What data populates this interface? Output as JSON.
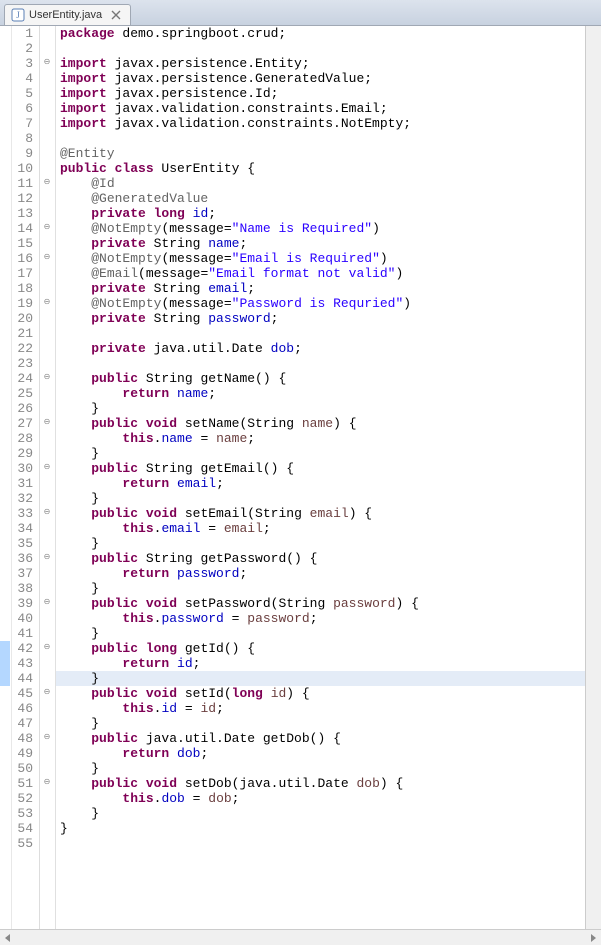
{
  "tab": {
    "filename": "UserEntity.java"
  },
  "lines": [
    {
      "n": 1,
      "m": "",
      "tokens": [
        [
          "kw",
          "package"
        ],
        [
          "id",
          " demo.springboot.crud;"
        ]
      ]
    },
    {
      "n": 2,
      "m": "",
      "tokens": []
    },
    {
      "n": 3,
      "m": "fold",
      "tokens": [
        [
          "kw",
          "import"
        ],
        [
          "id",
          " javax.persistence.Entity;"
        ]
      ]
    },
    {
      "n": 4,
      "m": "",
      "tokens": [
        [
          "kw",
          "import"
        ],
        [
          "id",
          " javax.persistence.GeneratedValue;"
        ]
      ]
    },
    {
      "n": 5,
      "m": "",
      "tokens": [
        [
          "kw",
          "import"
        ],
        [
          "id",
          " javax.persistence.Id;"
        ]
      ]
    },
    {
      "n": 6,
      "m": "",
      "tokens": [
        [
          "kw",
          "import"
        ],
        [
          "id",
          " javax.validation.constraints.Email;"
        ]
      ]
    },
    {
      "n": 7,
      "m": "",
      "tokens": [
        [
          "kw",
          "import"
        ],
        [
          "id",
          " javax.validation.constraints.NotEmpty;"
        ]
      ]
    },
    {
      "n": 8,
      "m": "",
      "tokens": []
    },
    {
      "n": 9,
      "m": "",
      "tokens": [
        [
          "ann",
          "@Entity"
        ]
      ]
    },
    {
      "n": 10,
      "m": "",
      "tokens": [
        [
          "kw",
          "public class"
        ],
        [
          "id",
          " UserEntity {"
        ]
      ]
    },
    {
      "n": 11,
      "m": "fold",
      "tokens": [
        [
          "id",
          "    "
        ],
        [
          "ann",
          "@Id"
        ]
      ]
    },
    {
      "n": 12,
      "m": "",
      "tokens": [
        [
          "id",
          "    "
        ],
        [
          "ann",
          "@GeneratedValue"
        ]
      ]
    },
    {
      "n": 13,
      "m": "",
      "tokens": [
        [
          "id",
          "    "
        ],
        [
          "kw",
          "private long"
        ],
        [
          "id",
          " "
        ],
        [
          "field",
          "id"
        ],
        [
          "id",
          ";"
        ]
      ]
    },
    {
      "n": 14,
      "m": "fold",
      "tokens": [
        [
          "id",
          "    "
        ],
        [
          "ann",
          "@NotEmpty"
        ],
        [
          "id",
          "(message="
        ],
        [
          "str",
          "\"Name is Required\""
        ],
        [
          "id",
          ")"
        ]
      ]
    },
    {
      "n": 15,
      "m": "",
      "tokens": [
        [
          "id",
          "    "
        ],
        [
          "kw",
          "private"
        ],
        [
          "id",
          " String "
        ],
        [
          "field",
          "name"
        ],
        [
          "id",
          ";"
        ]
      ]
    },
    {
      "n": 16,
      "m": "fold",
      "tokens": [
        [
          "id",
          "    "
        ],
        [
          "ann",
          "@NotEmpty"
        ],
        [
          "id",
          "(message="
        ],
        [
          "str",
          "\"Email is Required\""
        ],
        [
          "id",
          ")"
        ]
      ]
    },
    {
      "n": 17,
      "m": "",
      "tokens": [
        [
          "id",
          "    "
        ],
        [
          "ann",
          "@Email"
        ],
        [
          "id",
          "(message="
        ],
        [
          "str",
          "\"Email format not valid\""
        ],
        [
          "id",
          ")"
        ]
      ]
    },
    {
      "n": 18,
      "m": "",
      "tokens": [
        [
          "id",
          "    "
        ],
        [
          "kw",
          "private"
        ],
        [
          "id",
          " String "
        ],
        [
          "field",
          "email"
        ],
        [
          "id",
          ";"
        ]
      ]
    },
    {
      "n": 19,
      "m": "fold",
      "tokens": [
        [
          "id",
          "    "
        ],
        [
          "ann",
          "@NotEmpty"
        ],
        [
          "id",
          "(message="
        ],
        [
          "str",
          "\"Password is Requried\""
        ],
        [
          "id",
          ")"
        ]
      ]
    },
    {
      "n": 20,
      "m": "",
      "tokens": [
        [
          "id",
          "    "
        ],
        [
          "kw",
          "private"
        ],
        [
          "id",
          " String "
        ],
        [
          "field",
          "password"
        ],
        [
          "id",
          ";"
        ]
      ]
    },
    {
      "n": 21,
      "m": "",
      "tokens": []
    },
    {
      "n": 22,
      "m": "",
      "tokens": [
        [
          "id",
          "    "
        ],
        [
          "kw",
          "private"
        ],
        [
          "id",
          " java.util.Date "
        ],
        [
          "field",
          "dob"
        ],
        [
          "id",
          ";"
        ]
      ]
    },
    {
      "n": 23,
      "m": "",
      "tokens": []
    },
    {
      "n": 24,
      "m": "fold",
      "tokens": [
        [
          "id",
          "    "
        ],
        [
          "kw",
          "public"
        ],
        [
          "id",
          " String getName() {"
        ]
      ]
    },
    {
      "n": 25,
      "m": "",
      "tokens": [
        [
          "id",
          "        "
        ],
        [
          "kw",
          "return"
        ],
        [
          "id",
          " "
        ],
        [
          "field",
          "name"
        ],
        [
          "id",
          ";"
        ]
      ]
    },
    {
      "n": 26,
      "m": "",
      "tokens": [
        [
          "id",
          "    }"
        ]
      ]
    },
    {
      "n": 27,
      "m": "fold",
      "tokens": [
        [
          "id",
          "    "
        ],
        [
          "kw",
          "public void"
        ],
        [
          "id",
          " setName(String "
        ],
        [
          "param",
          "name"
        ],
        [
          "id",
          ") {"
        ]
      ]
    },
    {
      "n": 28,
      "m": "",
      "tokens": [
        [
          "id",
          "        "
        ],
        [
          "kw",
          "this"
        ],
        [
          "id",
          "."
        ],
        [
          "field",
          "name"
        ],
        [
          "id",
          " = "
        ],
        [
          "param",
          "name"
        ],
        [
          "id",
          ";"
        ]
      ]
    },
    {
      "n": 29,
      "m": "",
      "tokens": [
        [
          "id",
          "    }"
        ]
      ]
    },
    {
      "n": 30,
      "m": "fold",
      "tokens": [
        [
          "id",
          "    "
        ],
        [
          "kw",
          "public"
        ],
        [
          "id",
          " String getEmail() {"
        ]
      ]
    },
    {
      "n": 31,
      "m": "",
      "tokens": [
        [
          "id",
          "        "
        ],
        [
          "kw",
          "return"
        ],
        [
          "id",
          " "
        ],
        [
          "field",
          "email"
        ],
        [
          "id",
          ";"
        ]
      ]
    },
    {
      "n": 32,
      "m": "",
      "tokens": [
        [
          "id",
          "    }"
        ]
      ]
    },
    {
      "n": 33,
      "m": "fold",
      "tokens": [
        [
          "id",
          "    "
        ],
        [
          "kw",
          "public void"
        ],
        [
          "id",
          " setEmail(String "
        ],
        [
          "param",
          "email"
        ],
        [
          "id",
          ") {"
        ]
      ]
    },
    {
      "n": 34,
      "m": "",
      "tokens": [
        [
          "id",
          "        "
        ],
        [
          "kw",
          "this"
        ],
        [
          "id",
          "."
        ],
        [
          "field",
          "email"
        ],
        [
          "id",
          " = "
        ],
        [
          "param",
          "email"
        ],
        [
          "id",
          ";"
        ]
      ]
    },
    {
      "n": 35,
      "m": "",
      "tokens": [
        [
          "id",
          "    }"
        ]
      ]
    },
    {
      "n": 36,
      "m": "fold",
      "tokens": [
        [
          "id",
          "    "
        ],
        [
          "kw",
          "public"
        ],
        [
          "id",
          " String getPassword() {"
        ]
      ]
    },
    {
      "n": 37,
      "m": "",
      "tokens": [
        [
          "id",
          "        "
        ],
        [
          "kw",
          "return"
        ],
        [
          "id",
          " "
        ],
        [
          "field",
          "password"
        ],
        [
          "id",
          ";"
        ]
      ]
    },
    {
      "n": 38,
      "m": "",
      "tokens": [
        [
          "id",
          "    }"
        ]
      ]
    },
    {
      "n": 39,
      "m": "fold",
      "tokens": [
        [
          "id",
          "    "
        ],
        [
          "kw",
          "public void"
        ],
        [
          "id",
          " setPassword(String "
        ],
        [
          "param",
          "password"
        ],
        [
          "id",
          ") {"
        ]
      ]
    },
    {
      "n": 40,
      "m": "",
      "tokens": [
        [
          "id",
          "        "
        ],
        [
          "kw",
          "this"
        ],
        [
          "id",
          "."
        ],
        [
          "field",
          "password"
        ],
        [
          "id",
          " = "
        ],
        [
          "param",
          "password"
        ],
        [
          "id",
          ";"
        ]
      ]
    },
    {
      "n": 41,
      "m": "",
      "tokens": [
        [
          "id",
          "    }"
        ]
      ]
    },
    {
      "n": 42,
      "m": "fold",
      "tokens": [
        [
          "id",
          "    "
        ],
        [
          "kw",
          "public long"
        ],
        [
          "id",
          " getId() {"
        ]
      ],
      "open": true
    },
    {
      "n": 43,
      "m": "",
      "tokens": [
        [
          "id",
          "        "
        ],
        [
          "kw",
          "return"
        ],
        [
          "id",
          " "
        ],
        [
          "field",
          "id"
        ],
        [
          "id",
          ";"
        ]
      ]
    },
    {
      "n": 44,
      "m": "",
      "tokens": [
        [
          "id",
          "    }"
        ]
      ],
      "hl": true
    },
    {
      "n": 45,
      "m": "fold",
      "tokens": [
        [
          "id",
          "    "
        ],
        [
          "kw",
          "public void"
        ],
        [
          "id",
          " setId("
        ],
        [
          "kw",
          "long"
        ],
        [
          "id",
          " "
        ],
        [
          "param",
          "id"
        ],
        [
          "id",
          ") {"
        ]
      ]
    },
    {
      "n": 46,
      "m": "",
      "tokens": [
        [
          "id",
          "        "
        ],
        [
          "kw",
          "this"
        ],
        [
          "id",
          "."
        ],
        [
          "field",
          "id"
        ],
        [
          "id",
          " = "
        ],
        [
          "param",
          "id"
        ],
        [
          "id",
          ";"
        ]
      ]
    },
    {
      "n": 47,
      "m": "",
      "tokens": [
        [
          "id",
          "    }"
        ]
      ]
    },
    {
      "n": 48,
      "m": "fold",
      "tokens": [
        [
          "id",
          "    "
        ],
        [
          "kw",
          "public"
        ],
        [
          "id",
          " java.util.Date getDob() {"
        ]
      ]
    },
    {
      "n": 49,
      "m": "",
      "tokens": [
        [
          "id",
          "        "
        ],
        [
          "kw",
          "return"
        ],
        [
          "id",
          " "
        ],
        [
          "field",
          "dob"
        ],
        [
          "id",
          ";"
        ]
      ]
    },
    {
      "n": 50,
      "m": "",
      "tokens": [
        [
          "id",
          "    }"
        ]
      ]
    },
    {
      "n": 51,
      "m": "fold",
      "tokens": [
        [
          "id",
          "    "
        ],
        [
          "kw",
          "public void"
        ],
        [
          "id",
          " setDob(java.util.Date "
        ],
        [
          "param",
          "dob"
        ],
        [
          "id",
          ") {"
        ]
      ]
    },
    {
      "n": 52,
      "m": "",
      "tokens": [
        [
          "id",
          "        "
        ],
        [
          "kw",
          "this"
        ],
        [
          "id",
          "."
        ],
        [
          "field",
          "dob"
        ],
        [
          "id",
          " = "
        ],
        [
          "param",
          "dob"
        ],
        [
          "id",
          ";"
        ]
      ]
    },
    {
      "n": 53,
      "m": "",
      "tokens": [
        [
          "id",
          "    }"
        ]
      ]
    },
    {
      "n": 54,
      "m": "",
      "tokens": [
        [
          "id",
          "}"
        ]
      ]
    },
    {
      "n": 55,
      "m": "",
      "tokens": []
    }
  ],
  "highlight_range": {
    "start": 42,
    "end": 44
  }
}
